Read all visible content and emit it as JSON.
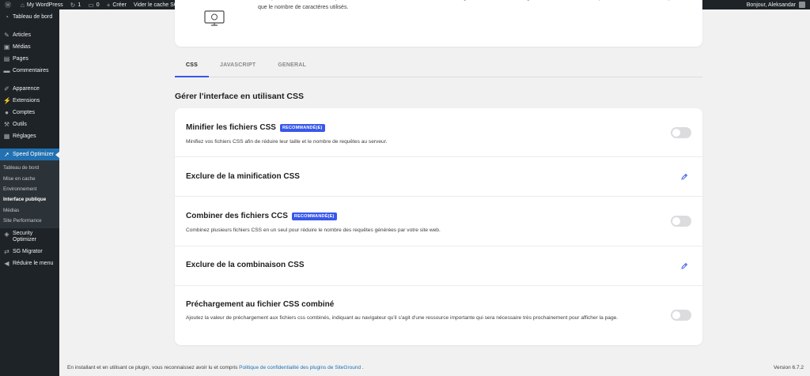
{
  "admin_bar": {
    "site_name": "My WordPress",
    "updates_count": "1",
    "comments_count": "0",
    "new_label": "Créer",
    "cache_label": "Vider le cache SG",
    "greeting": "Bonjour, Aleksandar"
  },
  "sidebar": {
    "dashboard": "Tableau de bord",
    "posts": "Articles",
    "media": "Médias",
    "pages": "Pages",
    "comments": "Commentaires",
    "appearance": "Apparence",
    "plugins": "Extensions",
    "users": "Comptes",
    "tools": "Outils",
    "settings": "Réglages",
    "speed_optimizer": "Speed Optimizer",
    "sub": [
      "Tableau de bord",
      "Mise en cache",
      "Environnement",
      "Interface publique",
      "Médias",
      "Site Performance"
    ],
    "security_optimizer_1": "Security",
    "security_optimizer_2": "Optimizer",
    "sg_migrator": "SG Migrator",
    "collapse": "Réduire le menu"
  },
  "intro": {
    "description": "Les optimisations de l'interface peuvent réduire considérablement la vitesse de chargement de votre site web grâce à divers modifications qui réduisent la taille des scripts ainsi que le nombre de caractères utilisés."
  },
  "tabs": [
    "CSS",
    "JAVASCRIPT",
    "GENERAL"
  ],
  "section_title": "Gérer l'interface en utilisant CSS",
  "badge_text": "RECOMMANDÉ(E)",
  "rows": {
    "minify_title": "Minifier les fichiers CSS",
    "minify_desc": "Minifiez vos fichiers CSS afin de réduire leur taille et le nombre de requêtes au serveur.",
    "exclude_minify_title": "Exclure de la minification CSS",
    "combine_title": "Combiner des fichiers CCS",
    "combine_desc": "Combinez plusieurs fichiers CSS en un seul pour réduire le nombre des requêtes générées par votre site web.",
    "exclude_combine_title": "Exclure de la combinaison CSS",
    "preload_title": "Préchargement au fichier CSS combiné",
    "preload_desc": "Ajoutez la valeur de préchargement aux fichiers css combinés, indiquant au navigateur qu'il s'agit d'une ressource importante qui sera nécessaire très prochainement pour afficher la page."
  },
  "footer": {
    "text": "En installant et en utilisant ce plugin, vous reconnaissez avoir lu et compris",
    "link": "Politique de confidentialité des plugins de SiteGround",
    "suffix": ".",
    "version": "Version 6.7.2"
  },
  "colors": {
    "accent": "#3858e9",
    "admin_dark": "#1d2327",
    "wp_blue": "#2271b1"
  }
}
